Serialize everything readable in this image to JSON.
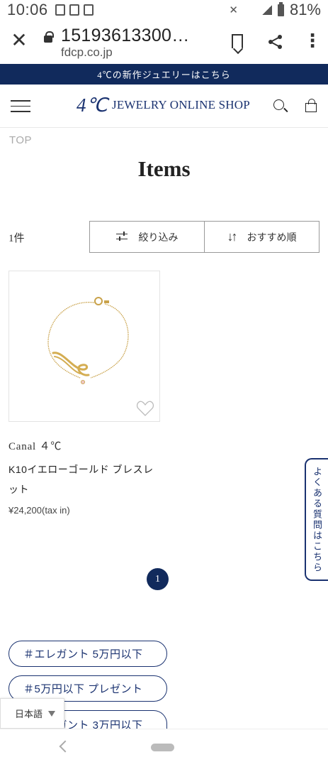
{
  "status_bar": {
    "time": "10:06",
    "battery": "81%"
  },
  "browser": {
    "close_label": "✕",
    "url_title": "15193613300…",
    "url_domain": "fdcp.co.jp",
    "more_label": "⋮"
  },
  "promo": {
    "text": "4℃の新作ジュエリーはこちら"
  },
  "header": {
    "logo": "4℃",
    "shop_name": "JEWELRY ONLINE SHOP"
  },
  "breadcrumb": "TOP",
  "page_title": "Items",
  "results": {
    "count": "1件",
    "filter_label": "絞り込み",
    "sort_icon_glyph": "↓↑",
    "sort_label": "おすすめ順"
  },
  "product": {
    "brand": "Canal ４℃",
    "name": "K10イエローゴールド ブレスレット",
    "price": "¥24,200(tax in)"
  },
  "faq": "よくある質問はこちら",
  "pagination": {
    "current": "1"
  },
  "tags": [
    "＃エレガント 5万円以下",
    "＃5万円以下 プレゼント",
    "＃エレガント 3万円以下"
  ],
  "language": "日本語",
  "colors": {
    "navy": "#112a5c",
    "brand_blue": "#1a3270",
    "gold": "#c9a24a"
  }
}
